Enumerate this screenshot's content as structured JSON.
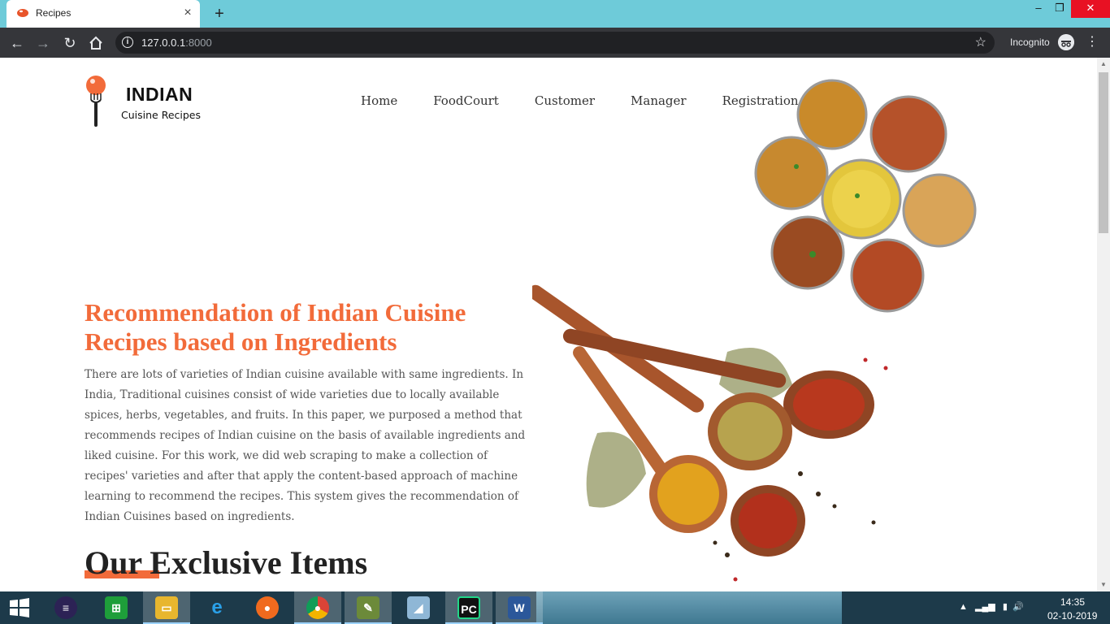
{
  "browser": {
    "tab_title": "Recipes",
    "tab_close": "×",
    "new_tab": "+",
    "url_host": "127.0.0.1",
    "url_port": ":8000",
    "incognito_label": "Incognito",
    "window_controls": {
      "minimize": "–",
      "restore": "❐",
      "close": "✕"
    },
    "icons": [
      "back-icon",
      "forward-icon",
      "reload-icon",
      "home-icon",
      "info-icon",
      "star-icon",
      "incognito-icon",
      "menu-icon"
    ]
  },
  "site": {
    "logo_title": "INDIAN",
    "logo_subtitle": "Cuisine Recipes",
    "nav": [
      "Home",
      "FoodCourt",
      "Customer",
      "Manager",
      "Registration"
    ]
  },
  "hero": {
    "title": "Recommendation of Indian Cuisine Recipes based on Ingredients",
    "description": "There are lots of varieties of Indian cuisine available with same ingredients. In India, Traditional cuisines consist of wide varieties due to locally available spices, herbs, vegetables, and fruits. In this paper, we purposed a method that recommends recipes of Indian cuisine on the basis of available ingredients and liked cuisine. For this work, we did web scraping to make a collection of recipes' varieties and after that apply the content-based approach of machine learning to recommend the recipes. This system gives the recommendation of Indian Cuisines based on ingredients."
  },
  "section": {
    "title": "Our Exclusive Items"
  },
  "colors": {
    "accent": "#f26b3a",
    "titlebar": "#6ecbd9",
    "toolbar": "#35363a"
  },
  "taskbar": {
    "apps": [
      "eclipse-icon",
      "store-icon",
      "file-explorer-icon",
      "internet-explorer-icon",
      "firefox-icon",
      "chrome-icon",
      "notepad-icon",
      "sketch-icon",
      "pycharm-icon",
      "word-icon"
    ],
    "time": "14:35",
    "date": "02-10-2019"
  }
}
